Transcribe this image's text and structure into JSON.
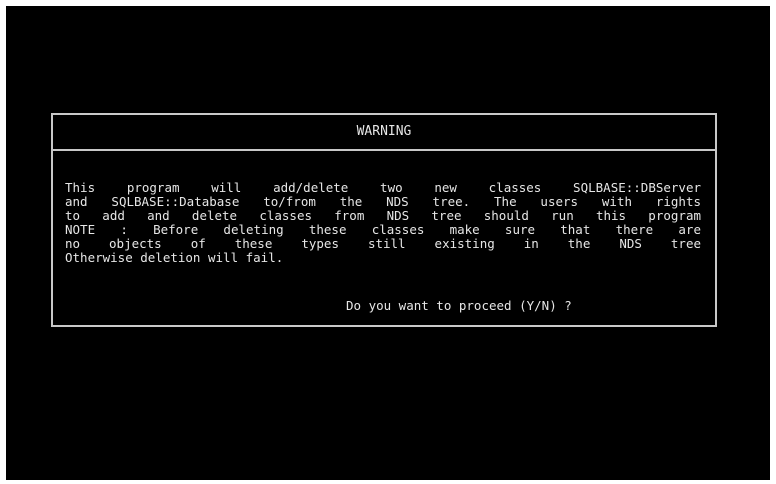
{
  "dialog": {
    "title": "WARNING",
    "lines": [
      "This program will add/delete two new classes SQLBASE::DBServer",
      "and SQLBASE::Database to/from the NDS tree. The users with rights",
      "to add and delete classes from NDS tree should run this program",
      "NOTE : Before deleting these classes make sure that there are",
      "no objects of these types still existing in the NDS tree",
      "Otherwise deletion will fail."
    ],
    "prompt": "Do you want to proceed (Y/N) ?"
  },
  "colors": {
    "screen_background": "#000000",
    "text": "#e6e6e6",
    "border": "#c8c8c8"
  }
}
